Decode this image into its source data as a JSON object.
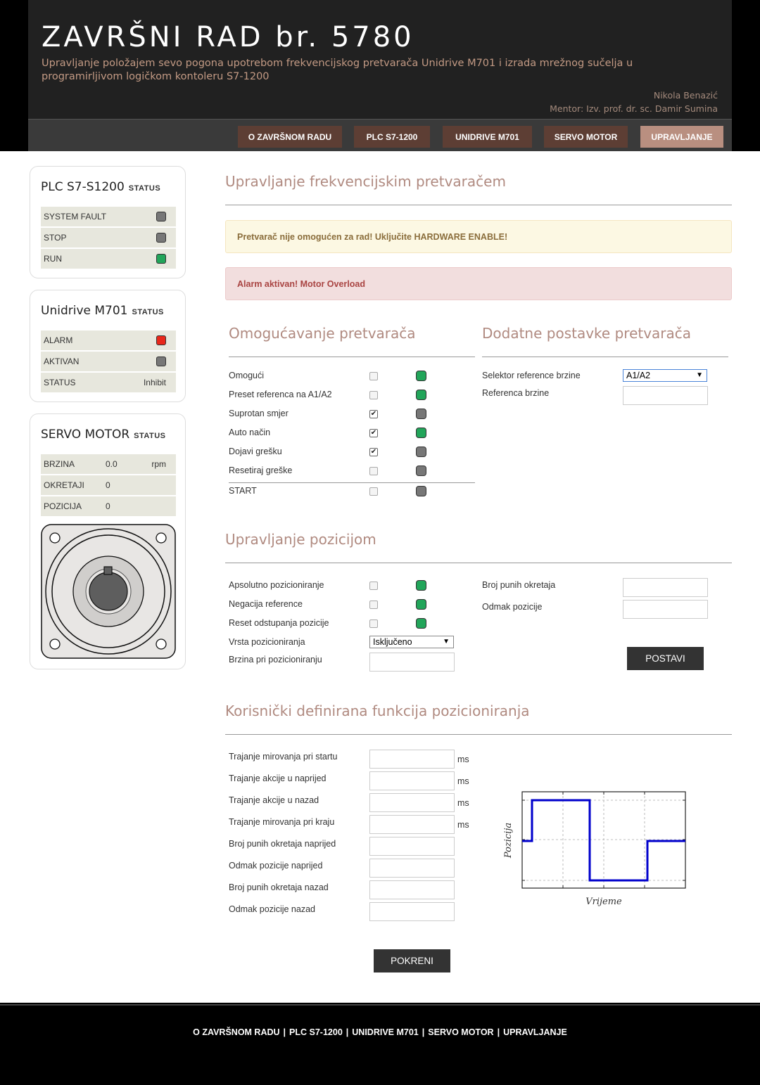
{
  "header": {
    "title": "ZAVRŠNI RAD br. 5780",
    "subtitle": "Upravljanje položajem sevo pogona upotrebom frekvencijskog pretvarača Unidrive M701 i izrada mrežnog sučelja u programirljivom logičkom kontoleru S7-1200",
    "author": "Nikola Benazić",
    "mentor": "Mentor: Izv. prof. dr. sc. Damir Sumina",
    "nav": [
      "O ZAVRŠNOM RADU",
      "PLC S7-1200",
      "UNIDRIVE M701",
      "SERVO MOTOR",
      "UPRAVLJANJE"
    ],
    "active_nav": "UPRAVLJANJE"
  },
  "sidebar": {
    "status_label": "STATUS",
    "plc": {
      "title": "PLC S7-S1200",
      "rows": [
        {
          "label": "SYSTEM FAULT",
          "led": "grey"
        },
        {
          "label": "STOP",
          "led": "grey"
        },
        {
          "label": "RUN",
          "led": "green"
        }
      ]
    },
    "unidrive": {
      "title": "Unidrive M701",
      "rows": [
        {
          "label": "ALARM",
          "led": "red"
        },
        {
          "label": "AKTIVAN",
          "led": "grey"
        },
        {
          "label": "STATUS",
          "value": "Inhibit"
        }
      ]
    },
    "servo": {
      "title": "SERVO MOTOR",
      "rows": [
        {
          "label": "BRZINA",
          "value": "0.0",
          "unit": "rpm"
        },
        {
          "label": "OKRETAJI",
          "value": "0"
        },
        {
          "label": "POZICIJA",
          "value": "0"
        }
      ]
    }
  },
  "main": {
    "title": "Upravljanje frekvencijskim pretvaračem",
    "alert_warning": "Pretvarač nije omogućen za rad! Uključite HARDWARE ENABLE!",
    "alert_danger": "Alarm aktivan! Motor Overload",
    "enable": {
      "title": "Omogućavanje pretvarača",
      "rows": [
        {
          "label": "Omogući",
          "checked": false,
          "ind": "green"
        },
        {
          "label": "Preset referenca na A1/A2",
          "checked": false,
          "ind": "green"
        },
        {
          "label": "Suprotan smjer",
          "checked": true,
          "ind": "grey"
        },
        {
          "label": "Auto način",
          "checked": true,
          "ind": "green"
        },
        {
          "label": "Dojavi grešku",
          "checked": true,
          "ind": "grey"
        },
        {
          "label": "Resetiraj greške",
          "checked": false,
          "ind": "grey"
        },
        {
          "label": "START",
          "checked": false,
          "ind": "grey"
        }
      ]
    },
    "extra": {
      "title": "Dodatne postavke pretvarača",
      "speed_selector_label": "Selektor reference brzine",
      "speed_selector_value": "A1/A2",
      "speed_ref_label": "Referenca brzine",
      "speed_ref_value": ""
    },
    "position": {
      "title": "Upravljanje pozicijom",
      "rows": [
        {
          "label": "Apsolutno pozicioniranje",
          "checked": false,
          "ind": "green"
        },
        {
          "label": "Negacija reference",
          "checked": false,
          "ind": "green"
        },
        {
          "label": "Reset odstupanja pozicije",
          "checked": false,
          "ind": "green"
        }
      ],
      "type_label": "Vrsta pozicioniranja",
      "type_value": "Isključeno",
      "speed_label": "Brzina pri pozicioniranju",
      "speed_value": "",
      "revs_label": "Broj punih okretaja",
      "revs_value": "",
      "offset_label": "Odmak pozicije",
      "offset_value": "",
      "set_button": "POSTAVI"
    },
    "custom": {
      "title": "Korisnički definirana funkcija pozicioniranja",
      "fields": [
        {
          "label": "Trajanje mirovanja pri startu",
          "value": "",
          "unit": "ms"
        },
        {
          "label": "Trajanje akcije u naprijed",
          "value": "",
          "unit": "ms"
        },
        {
          "label": "Trajanje akcije u nazad",
          "value": "",
          "unit": "ms"
        },
        {
          "label": "Trajanje mirovanja pri kraju",
          "value": "",
          "unit": "ms"
        },
        {
          "label": "Broj punih okretaja naprijed",
          "value": ""
        },
        {
          "label": "Odmak pozicije naprijed",
          "value": ""
        },
        {
          "label": "Broj punih okretaja nazad",
          "value": ""
        },
        {
          "label": "Odmak pozicije nazad",
          "value": ""
        }
      ],
      "plot_ylabel": "Pozicija",
      "plot_xlabel": "Vrijeme",
      "run_button": "POKRENI"
    }
  },
  "footer": {
    "links": [
      "O ZAVRŠNOM RADU",
      "PLC S7-1200",
      "UNIDRIVE M701",
      "SERVO MOTOR",
      "UPRAVLJANJE"
    ],
    "separator": "|"
  },
  "colors": {
    "nav_button": "#5d3e34",
    "nav_active": "#b98f80",
    "heading": "#b08a80",
    "led_green": "#22a55a",
    "led_grey": "#777777",
    "led_red": "#e8271a",
    "plot_line": "#0000cc"
  }
}
